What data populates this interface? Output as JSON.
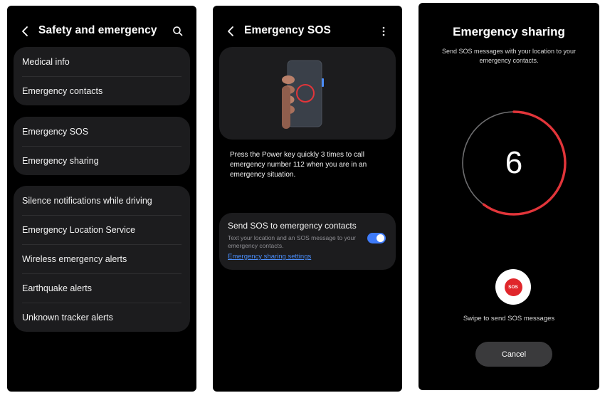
{
  "screen1": {
    "title": "Safety and emergency",
    "group1": [
      "Medical info",
      "Emergency contacts"
    ],
    "group2": [
      "Emergency SOS",
      "Emergency sharing"
    ],
    "group3": [
      "Silence notifications while driving",
      "Emergency Location Service",
      "Wireless emergency alerts",
      "Earthquake alerts",
      "Unknown tracker alerts"
    ]
  },
  "screen2": {
    "title": "Emergency SOS",
    "description": "Press the Power key quickly 3 times to call emergency number 112 when you are in an emergency situation.",
    "card": {
      "title": "Send SOS to emergency contacts",
      "subtitle": "Text your location and an SOS message to your emergency contacts.",
      "link": "Emergency sharing settings",
      "toggle_on": true
    }
  },
  "screen3": {
    "title": "Emergency sharing",
    "subtitle": "Send SOS messages with your location to your emergency contacts.",
    "countdown": "6",
    "countdown_progress": 0.6,
    "sos_label": "SOS",
    "swipe_text": "Swipe to send SOS messages",
    "cancel_label": "Cancel"
  },
  "colors": {
    "background": "#000000",
    "card": "#1c1c1e",
    "accent_blue": "#3e7bfa",
    "link_blue": "#4a8cf7",
    "sos_red": "#e0262b",
    "ring_red": "#e2353a",
    "ring_grey": "#6e6e70"
  },
  "icons": [
    "back-chevron-icon",
    "search-icon",
    "more-vertical-icon",
    "sos-icon"
  ]
}
